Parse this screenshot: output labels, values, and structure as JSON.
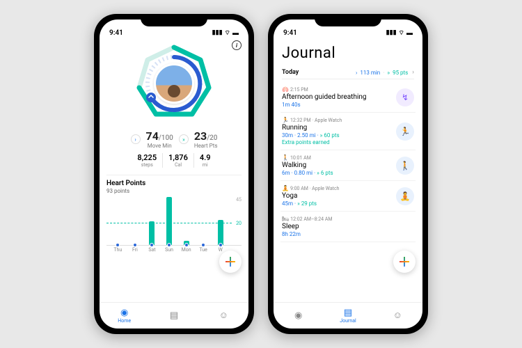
{
  "status": {
    "time": "9:41"
  },
  "home": {
    "info_icon": "i",
    "move_min": {
      "value": "74",
      "target": "/100",
      "label": "Move Min"
    },
    "heart_pts": {
      "value": "23",
      "target": "/20",
      "label": "Heart Pts"
    },
    "secondary": [
      {
        "value": "8,225",
        "unit": "steps"
      },
      {
        "value": "1,876",
        "unit": "Cal"
      },
      {
        "value": "4.9",
        "unit": "mi"
      }
    ],
    "chart": {
      "title": "Heart Points",
      "subtitle": "93 points",
      "y_max_label": "45",
      "goal_label": "20"
    },
    "nav": {
      "home": "Home"
    }
  },
  "journal": {
    "title": "Journal",
    "today": {
      "label": "Today",
      "move_min": "113 min",
      "heart_pts": "95 pts"
    },
    "entries": [
      {
        "time": "2:15 PM",
        "source": "",
        "title": "Afternoon guided breathing",
        "detail": "1m 40s",
        "extra": "",
        "icon": "↯",
        "badge_class": "purple",
        "glyph": "🫁"
      },
      {
        "time": "12:32 PM",
        "source": " · Apple Watch",
        "title": "Running",
        "detail": "30m · 2.50 mi · ",
        "hp": "60 pts",
        "extra": "Extra points earned",
        "icon": "🏃",
        "badge_class": "blue",
        "glyph": "🏃"
      },
      {
        "time": "10:01 AM",
        "source": "",
        "title": "Walking",
        "detail": "6m · 0.80 mi · ",
        "hp": "6 pts",
        "extra": "",
        "icon": "🚶",
        "badge_class": "blue",
        "glyph": "🚶"
      },
      {
        "time": "9:00 AM",
        "source": " · Apple Watch",
        "title": "Yoga",
        "detail": "45m · ",
        "hp": "29 pts",
        "extra": "",
        "icon": "🧘",
        "badge_class": "blue",
        "glyph": "🧘"
      },
      {
        "time": "12:02 AM–8:24 AM",
        "source": "",
        "title": "Sleep",
        "detail": "8h 22m",
        "extra": "",
        "icon": "🛏",
        "badge_class": "",
        "glyph": "🛏"
      }
    ],
    "nav": {
      "journal": "Journal"
    }
  },
  "chart_data": {
    "type": "bar",
    "categories": [
      "Thu",
      "Fri",
      "Sat",
      "Sun",
      "Mon",
      "Tue",
      "W"
    ],
    "values": [
      0,
      0,
      22,
      45,
      4,
      0,
      23
    ],
    "title": "Heart Points",
    "ylabel": "",
    "ylim": [
      0,
      45
    ],
    "goal_line": 20
  }
}
